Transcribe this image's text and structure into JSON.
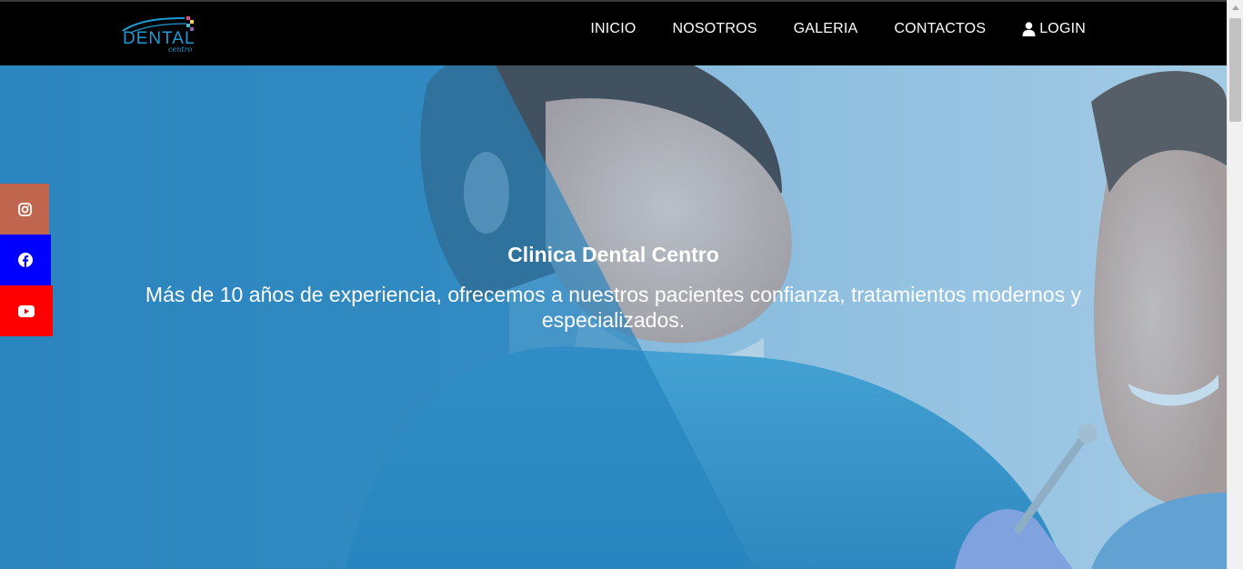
{
  "brand": {
    "name": "DENTAL",
    "sub": "centro"
  },
  "nav": {
    "items": [
      {
        "label": "INICIO"
      },
      {
        "label": "NOSOTROS"
      },
      {
        "label": "GALERIA"
      },
      {
        "label": "CONTACTOS"
      },
      {
        "label": "LOGIN"
      }
    ]
  },
  "hero": {
    "title": "Clinica Dental Centro",
    "subtitle": "Más de 10 años de experiencia, ofrecemos a nuestros pacientes confianza, tratamientos modernos y especializados."
  },
  "social": [
    {
      "icon": "instagram-icon",
      "color": "#c0664f"
    },
    {
      "icon": "facebook-icon",
      "color": "#0000ff"
    },
    {
      "icon": "youtube-icon",
      "color": "#ff0000"
    }
  ],
  "colors": {
    "navbar": "#000000",
    "brand": "#1e9bd7",
    "hero_overlay": "#2b86c0"
  }
}
